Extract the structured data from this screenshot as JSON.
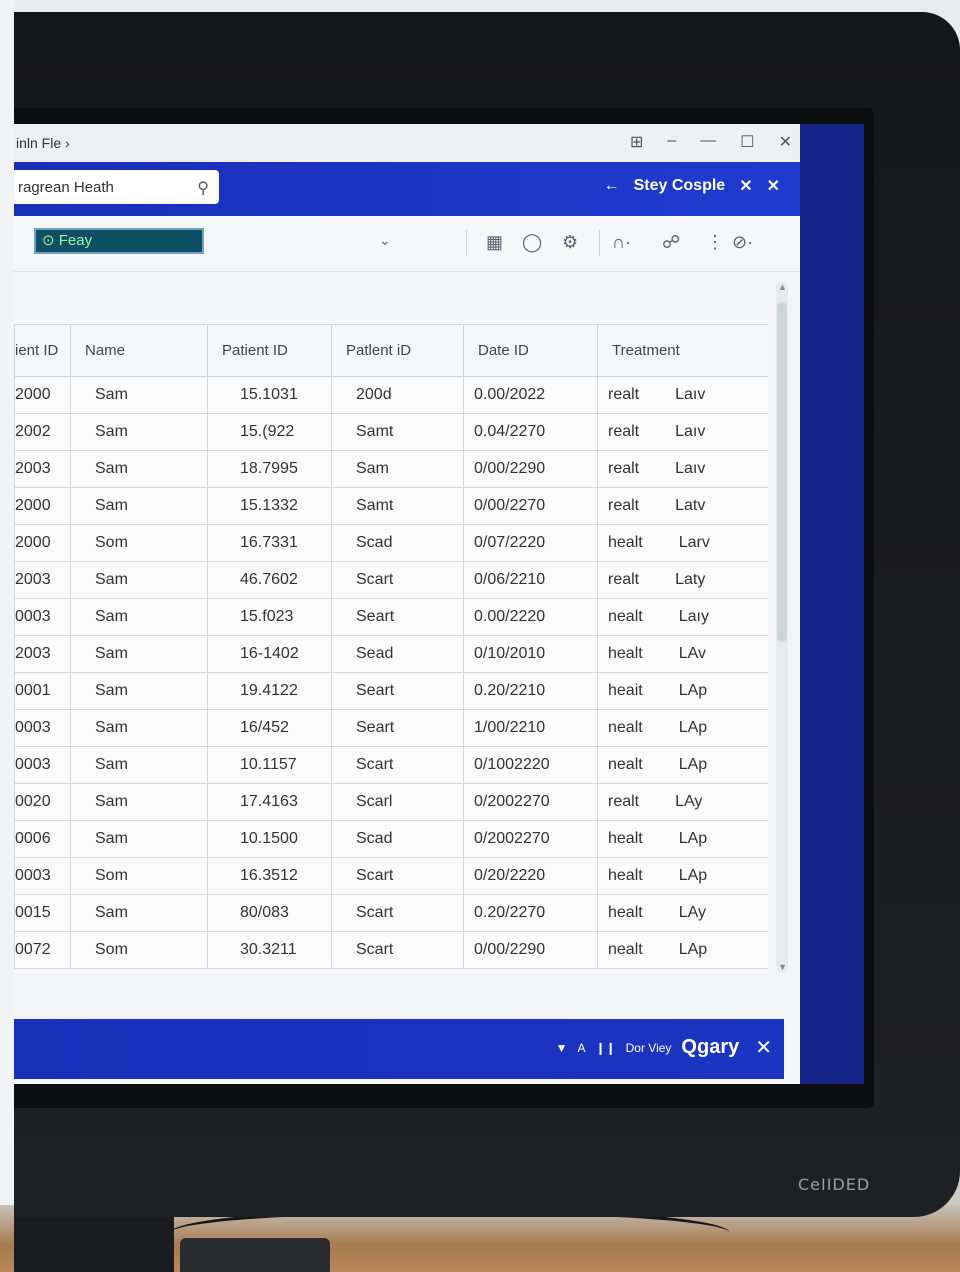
{
  "window": {
    "title": "inln Fle ›",
    "controls": [
      "⊞",
      "–",
      "—",
      "☐",
      "✕"
    ]
  },
  "bluebar": {
    "search_value": "ragrean Heath",
    "right_title": "Stey Cosple",
    "back_arrow": "←"
  },
  "toolbar": {
    "filter_label": "⊙ Feay"
  },
  "table": {
    "headers": [
      "ient ID",
      "Name",
      "Patient ID",
      "Patlent iD",
      "Date ID",
      "Treatment"
    ],
    "rows": [
      [
        "2000",
        "Sam",
        "15.1031",
        "200d",
        "0.00/2022",
        "realt",
        "Laıv"
      ],
      [
        "2002",
        "Sam",
        "15.(922",
        "Samt",
        "0.04/2270",
        "realt",
        "Laıv"
      ],
      [
        "2003",
        "Sam",
        "18.7995",
        "Sam",
        "0/00/2290",
        "realt",
        "Laıv"
      ],
      [
        "2000",
        "Sam",
        "15.1332",
        "Samt",
        "0/00/2270",
        "realt",
        "Latv"
      ],
      [
        "2000",
        "Som",
        "16.7331",
        "Scad",
        "0/07/2220",
        "healt",
        "Larv"
      ],
      [
        "2003",
        "Sam",
        "46.7602",
        "Scart",
        "0/06/2210",
        "realt",
        "Laty"
      ],
      [
        "0003",
        "Sam",
        "15.f023",
        "Seart",
        "0.00/2220",
        "nealt",
        "Laıy"
      ],
      [
        "2003",
        "Sam",
        "16-1402",
        "Sead",
        "0/10/2010",
        "healt",
        "LAv"
      ],
      [
        "0001",
        "Sam",
        "19.4122",
        "Seart",
        "0.20/2210",
        "heait",
        "LAp"
      ],
      [
        "0003",
        "Sam",
        "16/452",
        "Seart",
        "1/00/2210",
        "nealt",
        "LAp"
      ],
      [
        "0003",
        "Sam",
        "10.1157",
        "Scart",
        "0/1002220",
        "nealt",
        "LAp"
      ],
      [
        "0020",
        "Sam",
        "17.4163",
        "Scarl",
        "0/2002270",
        "realt",
        "LAy"
      ],
      [
        "0006",
        "Sam",
        "10.1500",
        "Scad",
        "0/2002270",
        "healt",
        "LAp"
      ],
      [
        "0003",
        "Som",
        "16.3512",
        "Scart",
        "0/20/2220",
        "healt",
        "LAp"
      ],
      [
        "0015",
        "Sam",
        "80/083",
        "Scart",
        "0.20/2270",
        "healt",
        "LAy"
      ],
      [
        "0072",
        "Som",
        "30.3211",
        "Scart",
        "0/00/2290",
        "nealt",
        "LAp"
      ]
    ]
  },
  "statusbar": {
    "label_small": "Dor Viey",
    "label_big": "Qgary"
  },
  "monitor": {
    "brand": "CeIIDED"
  }
}
